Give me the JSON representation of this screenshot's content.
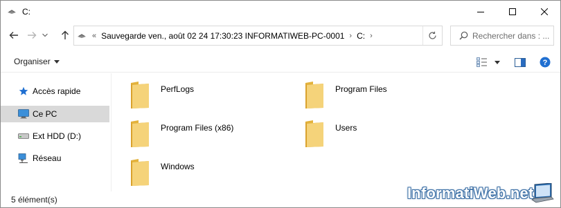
{
  "window": {
    "title": "C:",
    "controls": [
      "minimize-icon",
      "maximize-icon",
      "close-icon"
    ]
  },
  "address": {
    "overflow": "«",
    "crumbs": [
      {
        "label": "Sauvegarde ven., août 02 24 17:30:23 INFORMATIWEB-PC-0001"
      },
      {
        "label": "C:"
      }
    ],
    "separator": "›",
    "search_placeholder": "Rechercher dans : ..."
  },
  "commandbar": {
    "organize_label": "Organiser",
    "icons": [
      "view-options-icon",
      "preview-pane-icon",
      "help-icon"
    ]
  },
  "navpane": {
    "items": [
      {
        "label": "Accès rapide",
        "icon": "star-icon",
        "selected": false
      },
      {
        "label": "Ce PC",
        "icon": "computer-icon",
        "selected": true
      },
      {
        "label": "Ext HDD (D:)",
        "icon": "drive-icon",
        "selected": false
      },
      {
        "label": "Réseau",
        "icon": "network-icon",
        "selected": false
      }
    ]
  },
  "files": [
    {
      "name": "PerfLogs",
      "icon": "folder-icon"
    },
    {
      "name": "Program Files",
      "icon": "folder-icon"
    },
    {
      "name": "Program Files (x86)",
      "icon": "folder-icon"
    },
    {
      "name": "Users",
      "icon": "folder-icon"
    },
    {
      "name": "Windows",
      "icon": "folder-icon"
    }
  ],
  "status": {
    "item_count": "5 élément(s)"
  },
  "watermark": {
    "text": "InformatiWeb.net"
  },
  "colors": {
    "folder": "#f0c75e",
    "selected_nav": "#d9d9d9",
    "star": "#1f6fd1",
    "help": "#1f6fd1"
  }
}
